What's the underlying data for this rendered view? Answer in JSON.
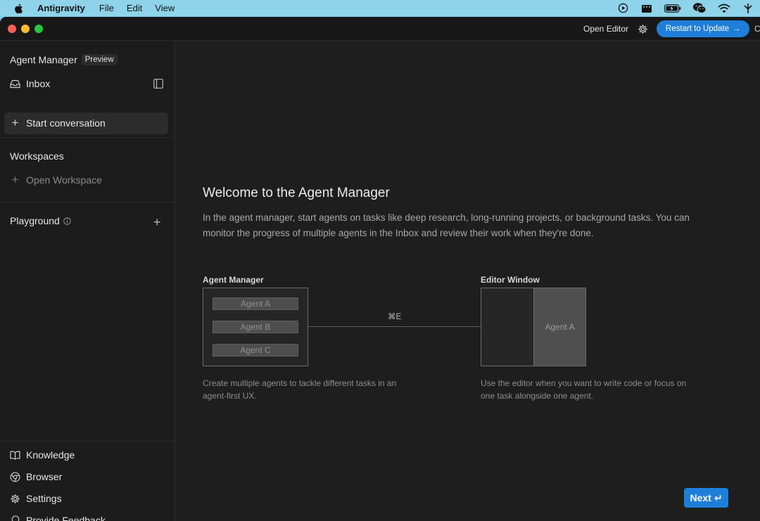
{
  "menubar": {
    "app_name": "Antigravity",
    "menus": [
      "File",
      "Edit",
      "View"
    ],
    "status_icons": [
      "play-circle-icon",
      "clapperboard-icon",
      "battery-charging-icon",
      "wechat-icon",
      "wifi-icon",
      "antenna-icon"
    ]
  },
  "titlebar": {
    "open_editor": "Open Editor",
    "restart_label": "Restart to Update",
    "restart_arrow": "→",
    "cut_text": "C"
  },
  "sidebar": {
    "title": "Agent Manager",
    "badge": "Preview",
    "inbox": "Inbox",
    "start_conversation": "Start conversation",
    "workspaces_title": "Workspaces",
    "open_workspace": "Open Workspace",
    "playground": "Playground",
    "playground_plus": "+",
    "bottom_items": [
      "Knowledge",
      "Browser",
      "Settings",
      "Provide Feedback"
    ]
  },
  "main": {
    "title": "Welcome to the Agent Manager",
    "description": "In the agent manager, start agents on tasks like deep research, long-running projects, or background tasks. You can monitor the progress of multiple agents in the Inbox and review their work when they're done.",
    "diagram": {
      "left_label": "Agent Manager",
      "agents": [
        "Agent A",
        "Agent B",
        "Agent C"
      ],
      "shortcut": "⌘E",
      "right_label": "Editor Window",
      "editor_agent": "Agent A",
      "left_caption": "Create multiple agents to tackle different tasks in an agent-first UX.",
      "right_caption": "Use the editor when you want to write code or focus on one task alongside one agent."
    },
    "next_label": "Next",
    "next_icon": "↵"
  },
  "colors": {
    "accent": "#1f7fd8",
    "background": "#1e1e1e",
    "sidebar": "#1c1c1c",
    "menubar": "#8fd3ea"
  }
}
